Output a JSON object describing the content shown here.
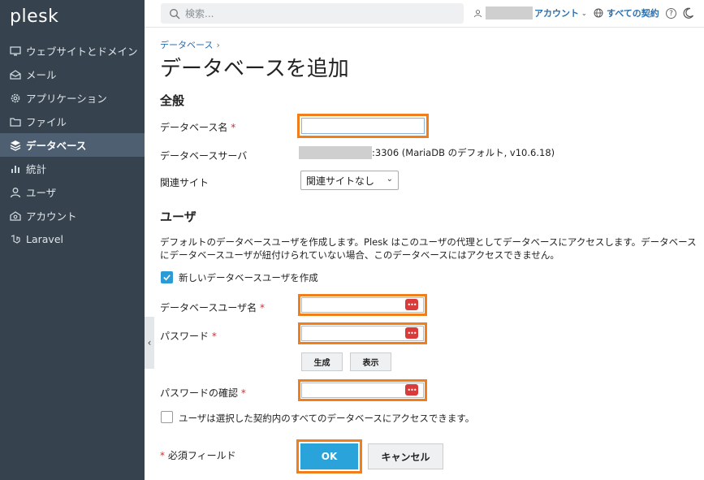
{
  "brand": {
    "logo": "plesk"
  },
  "sidebar": {
    "items": [
      {
        "label": "ウェブサイトとドメイン",
        "icon": "monitor-icon"
      },
      {
        "label": "メール",
        "icon": "mail-icon"
      },
      {
        "label": "アプリケーション",
        "icon": "gear-icon"
      },
      {
        "label": "ファイル",
        "icon": "folder-icon"
      },
      {
        "label": "データベース",
        "icon": "layers-icon",
        "active": true
      },
      {
        "label": "統計",
        "icon": "bar-chart-icon"
      },
      {
        "label": "ユーザ",
        "icon": "user-icon"
      },
      {
        "label": "アカウント",
        "icon": "account-icon"
      },
      {
        "label": "Laravel",
        "icon": "laravel-icon"
      }
    ],
    "collapse_glyph": "‹"
  },
  "header": {
    "search_placeholder": "検索...",
    "account_label": "アカウント",
    "contracts_label": "すべての契約",
    "help_glyph": "?"
  },
  "main": {
    "breadcrumb": "データベース",
    "breadcrumb_sep": "›",
    "title": "データベースを追加",
    "general_section": "全般",
    "db_name_label": "データベース名",
    "db_name_value": "",
    "db_server_label": "データベースサーバ",
    "db_server_value": ":3306 (MariaDB のデフォルト, v10.6.18)",
    "related_site_label": "関連サイト",
    "related_site_value": "関連サイトなし",
    "user_section": "ユーザ",
    "user_description": "デフォルトのデータベースユーザを作成します。Plesk はこのユーザの代理としてデータベースにアクセスします。データベースにデータベースユーザが紐付けられていない場合、このデータベースにはアクセスできません。",
    "create_user_label": "新しいデータベースユーザを作成",
    "db_user_label": "データベースユーザ名",
    "password_label": "パスワード",
    "generate_button": "生成",
    "show_button": "表示",
    "confirm_password_label": "パスワードの確認",
    "all_db_access_label": "ユーザは選択した契約内のすべてのデータベースにアクセスできます。",
    "required_note": "必須フィールド",
    "required_mark": "*",
    "ok_button": "OK",
    "cancel_button": "キャンセル",
    "dots_glyph": "•••"
  },
  "colors": {
    "sidebar": "#36434f",
    "accent": "#2aa3db",
    "highlight": "#f07f1b",
    "link": "#2a6fb0"
  }
}
